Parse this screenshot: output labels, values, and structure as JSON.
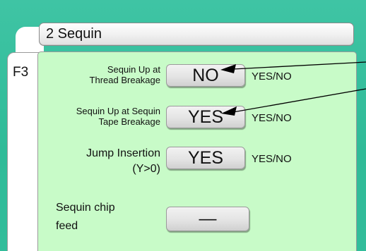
{
  "title": "2 Sequin",
  "tab": {
    "label": "F3"
  },
  "settings": [
    {
      "label_line1": "Sequin Up at",
      "label_line2": "Thread Breakage",
      "value": "NO",
      "options": "YES/NO"
    },
    {
      "label_line1": "Sequin Up at Sequin",
      "label_line2": "Tape Breakage",
      "value": "YES",
      "options": "YES/NO"
    },
    {
      "label_line1": "Jump Insertion",
      "label_line2": "(Y>0)",
      "value": "YES",
      "options": "YES/NO"
    },
    {
      "label_line1": "Sequin chip",
      "label_line2": "feed",
      "value": "—"
    }
  ]
}
